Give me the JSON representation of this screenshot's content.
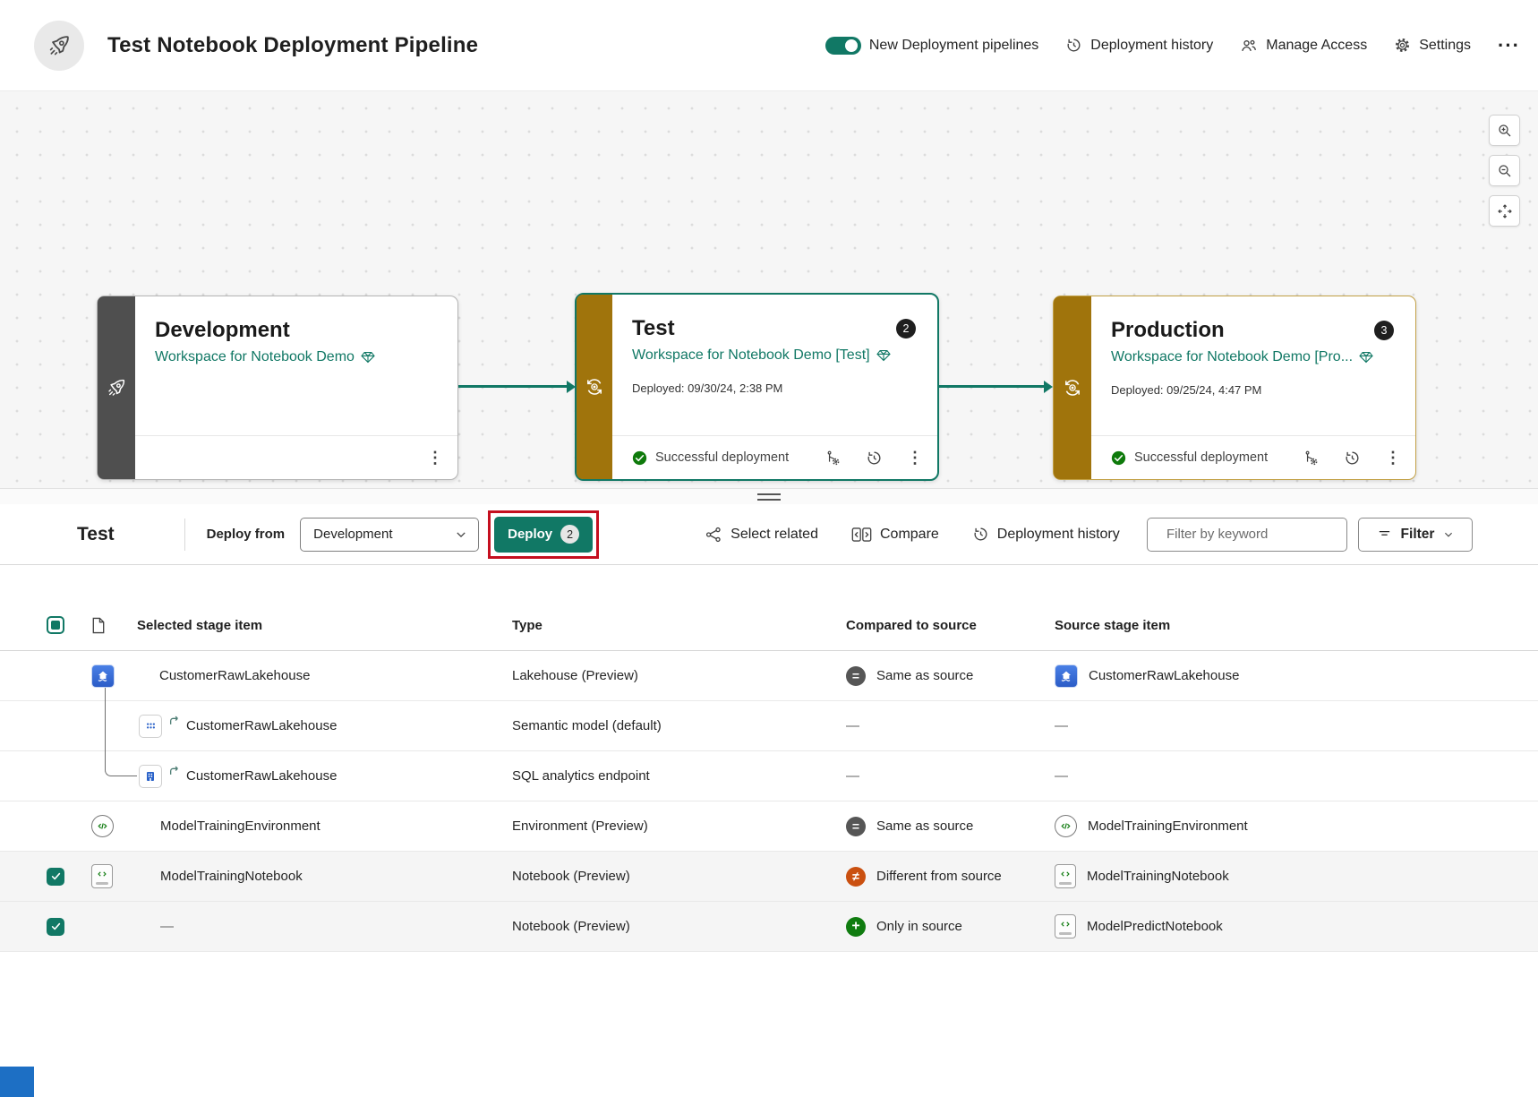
{
  "colors": {
    "accent_teal": "#117865",
    "rail_gold": "#a0740c",
    "rail_dark": "#4f4f4f",
    "annotation_red": "#c50f1f",
    "status_same": "#565656",
    "status_different": "#ca5010",
    "status_only": "#107c10"
  },
  "glyphs": {
    "ellipsis_v": "⋮",
    "ellipsis_h": "···",
    "equal": "=",
    "not_equal": "≠",
    "plus": "+"
  },
  "header": {
    "title": "Test Notebook Deployment Pipeline",
    "toggle_label": "New Deployment pipelines",
    "deployment_history_label": "Deployment history",
    "manage_access_label": "Manage Access",
    "settings_label": "Settings"
  },
  "stages": [
    {
      "name": "Development",
      "workspace": "Workspace for Notebook Demo",
      "badge": "",
      "deployed": "",
      "status": ""
    },
    {
      "name": "Test",
      "workspace": "Workspace for Notebook Demo [Test]",
      "badge": "2",
      "deployed": "Deployed: 09/30/24, 2:38 PM",
      "status": "Successful deployment"
    },
    {
      "name": "Production",
      "workspace": "Workspace for Notebook Demo [Pro...",
      "badge": "3",
      "deployed": "Deployed: 09/25/24, 4:47 PM",
      "status": "Successful deployment"
    }
  ],
  "stage_panel": {
    "stage_name": "Test",
    "deploy_from_label": "Deploy from",
    "deploy_from_value": "Development",
    "deploy_button": "Deploy",
    "deploy_badge": "2",
    "select_related": "Select related",
    "compare": "Compare",
    "deployment_history": "Deployment history",
    "search_placeholder": "Filter by keyword",
    "filter": "Filter"
  },
  "table": {
    "headers": {
      "selected": "Selected stage item",
      "type": "Type",
      "compared": "Compared to source",
      "source": "Source stage item"
    },
    "rows": [
      {
        "name": "CustomerRawLakehouse",
        "type": "Lakehouse (Preview)",
        "compared": "Same as source",
        "source": "CustomerRawLakehouse"
      },
      {
        "name": "CustomerRawLakehouse",
        "type": "Semantic model (default)",
        "compared": "—",
        "source": "—"
      },
      {
        "name": "CustomerRawLakehouse",
        "type": "SQL analytics endpoint",
        "compared": "—",
        "source": "—"
      },
      {
        "name": "ModelTrainingEnvironment",
        "type": "Environment (Preview)",
        "compared": "Same as source",
        "source": "ModelTrainingEnvironment"
      },
      {
        "name": "ModelTrainingNotebook",
        "type": "Notebook (Preview)",
        "compared": "Different from source",
        "source": "ModelTrainingNotebook"
      },
      {
        "name": "—",
        "type": "Notebook (Preview)",
        "compared": "Only in source",
        "source": "ModelPredictNotebook"
      }
    ]
  }
}
